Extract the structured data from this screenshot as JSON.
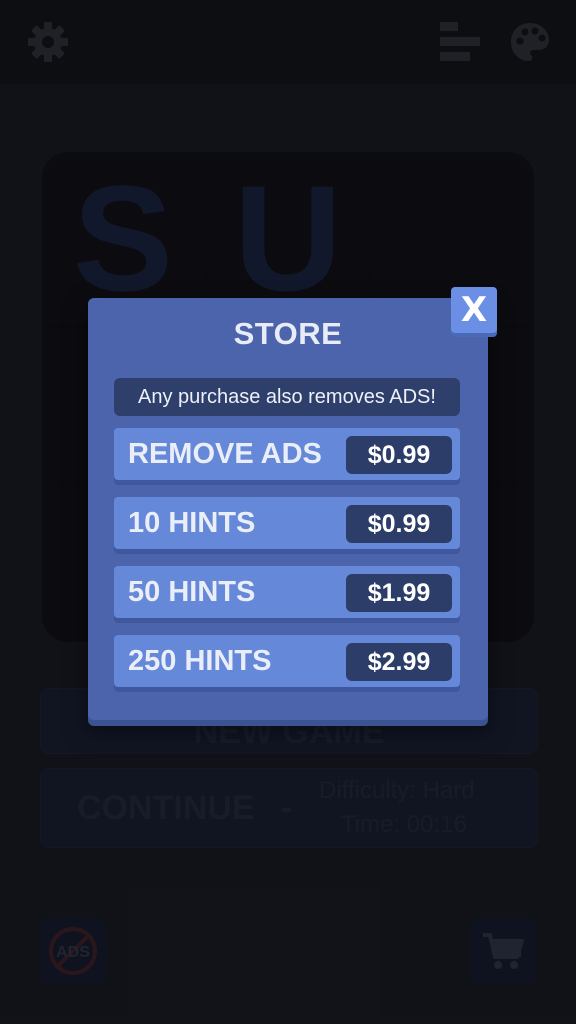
{
  "store": {
    "title": "STORE",
    "close_label": "X",
    "notice": "Any purchase also removes ADS!",
    "items": [
      {
        "label": "REMOVE ADS",
        "price": "$0.99"
      },
      {
        "label": "10 HINTS",
        "price": "$0.99"
      },
      {
        "label": "50 HINTS",
        "price": "$1.99"
      },
      {
        "label": "250 HINTS",
        "price": "$2.99"
      }
    ]
  },
  "background": {
    "logo_letters": [
      "S",
      "U",
      "",
      "",
      "",
      "",
      "",
      "",
      ""
    ],
    "new_game_label": "NEW GAME",
    "continue_label": "CONTINUE",
    "continue_separator": "-",
    "difficulty_text": "Difficulty: Hard",
    "time_text": "Time: 00:16",
    "no_ads_label": "ADS"
  },
  "icons": {
    "settings": "gear-icon",
    "leaderboard": "bars-icon",
    "theme": "palette-icon",
    "cart": "cart-icon"
  }
}
